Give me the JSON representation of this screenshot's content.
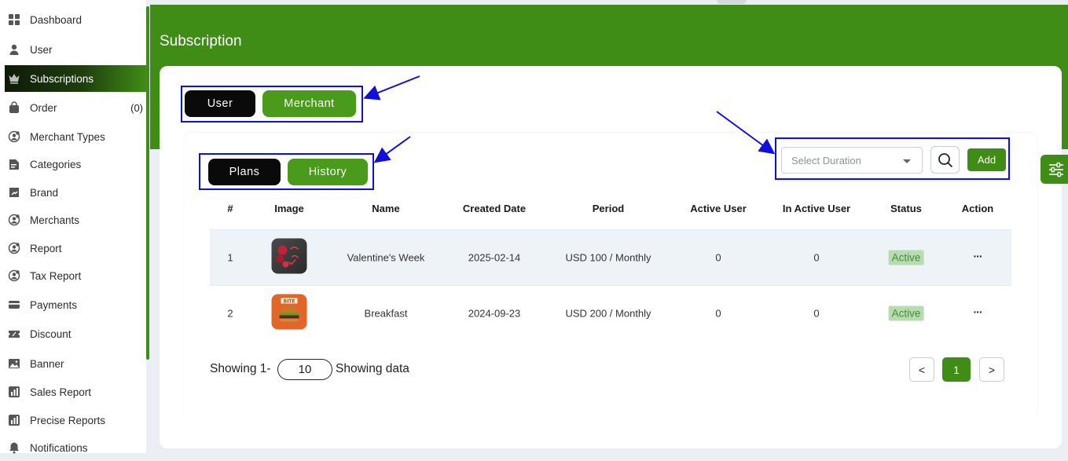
{
  "sidebar": {
    "items": [
      {
        "label": "Dashboard",
        "icon": "dashboard-grid-icon"
      },
      {
        "label": "User",
        "icon": "user-icon"
      },
      {
        "label": "Subscriptions",
        "icon": "crown-icon",
        "active": true
      },
      {
        "label": "Order",
        "icon": "bag-icon",
        "count": "(0)"
      },
      {
        "label": "Merchant Types",
        "icon": "merchant-user-icon"
      },
      {
        "label": "Categories",
        "icon": "categories-icon"
      },
      {
        "label": "Brand",
        "icon": "tag-icon"
      },
      {
        "label": "Merchants",
        "icon": "merchant-user-icon"
      },
      {
        "label": "Report",
        "icon": "report-user-icon"
      },
      {
        "label": "Tax Report",
        "icon": "report-user-icon"
      },
      {
        "label": "Payments",
        "icon": "card-icon"
      },
      {
        "label": "Discount",
        "icon": "ticket-icon"
      },
      {
        "label": "Banner",
        "icon": "image-icon"
      },
      {
        "label": "Sales Report",
        "icon": "chart-icon"
      },
      {
        "label": "Precise Reports",
        "icon": "chart-icon"
      },
      {
        "label": "Notifications",
        "icon": "bell-icon"
      }
    ]
  },
  "page": {
    "title": "Subscription"
  },
  "top_tabs": {
    "user": "User",
    "merchant": "Merchant"
  },
  "sub_tabs": {
    "plans": "Plans",
    "history": "History"
  },
  "toolbar": {
    "duration_placeholder": "Select Duration",
    "add_label": "Add"
  },
  "table": {
    "headers": [
      "#",
      "Image",
      "Name",
      "Created Date",
      "Period",
      "Active User",
      "In Active User",
      "Status",
      "Action"
    ],
    "rows": [
      {
        "index": "1",
        "image": "valentine-thumbnail",
        "name": "Valentine's Week",
        "created": "2025-02-14",
        "period": "USD 100 / Monthly",
        "active": "0",
        "inactive": "0",
        "status": "Active",
        "action": "···"
      },
      {
        "index": "2",
        "image": "burger-thumbnail",
        "name": "Breakfast",
        "created": "2024-09-23",
        "period": "USD 200 / Monthly",
        "active": "0",
        "inactive": "0",
        "status": "Active",
        "action": "···"
      }
    ]
  },
  "footer": {
    "showing_prefix": "Showing 1-",
    "per_page": "10",
    "showing_suffix": "Showing data"
  },
  "pagination": {
    "prev": "<",
    "current": "1",
    "next": ">"
  },
  "colors": {
    "brand_green": "#3f8c16",
    "tab_black": "#0a0a0a",
    "annotation_blue": "#1010d8",
    "status_bg": "#b6dcb0"
  }
}
